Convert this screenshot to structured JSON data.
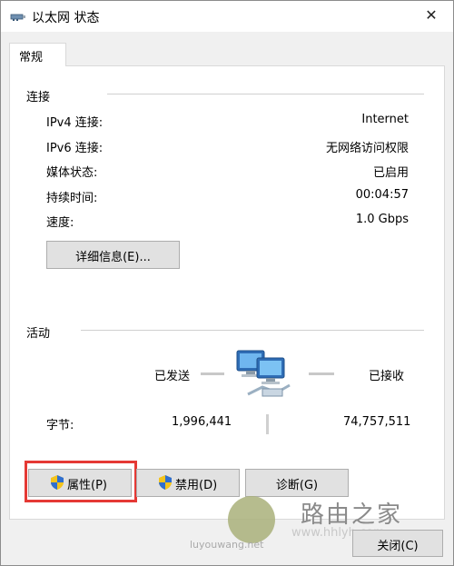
{
  "window": {
    "title": "以太网 状态",
    "close_glyph": "✕"
  },
  "tabs": [
    {
      "label": "常规"
    }
  ],
  "connection": {
    "heading": "连接",
    "rows": [
      {
        "label": "IPv4 连接:",
        "value": "Internet"
      },
      {
        "label": "IPv6 连接:",
        "value": "无网络访问权限"
      },
      {
        "label": "媒体状态:",
        "value": "已启用"
      },
      {
        "label": "持续时间:",
        "value": "00:04:57"
      },
      {
        "label": "速度:",
        "value": "1.0 Gbps"
      }
    ],
    "details_button": "详细信息(E)..."
  },
  "activity": {
    "heading": "活动",
    "sent_label": "已发送",
    "received_label": "已接收",
    "bytes_label": "字节:",
    "bytes_sent": "1,996,441",
    "bytes_received": "74,757,511"
  },
  "buttons": {
    "properties": "属性(P)",
    "disable": "禁用(D)",
    "diagnose": "诊断(G)",
    "close": "关闭(C)"
  },
  "watermark": {
    "brand": "路由之家",
    "url": "www.hhlyh.com",
    "small": "luyouwang.net"
  },
  "colors": {
    "highlight": "#e53935",
    "button_bg": "#e1e1e1",
    "client_bg": "#f0f0f0"
  }
}
